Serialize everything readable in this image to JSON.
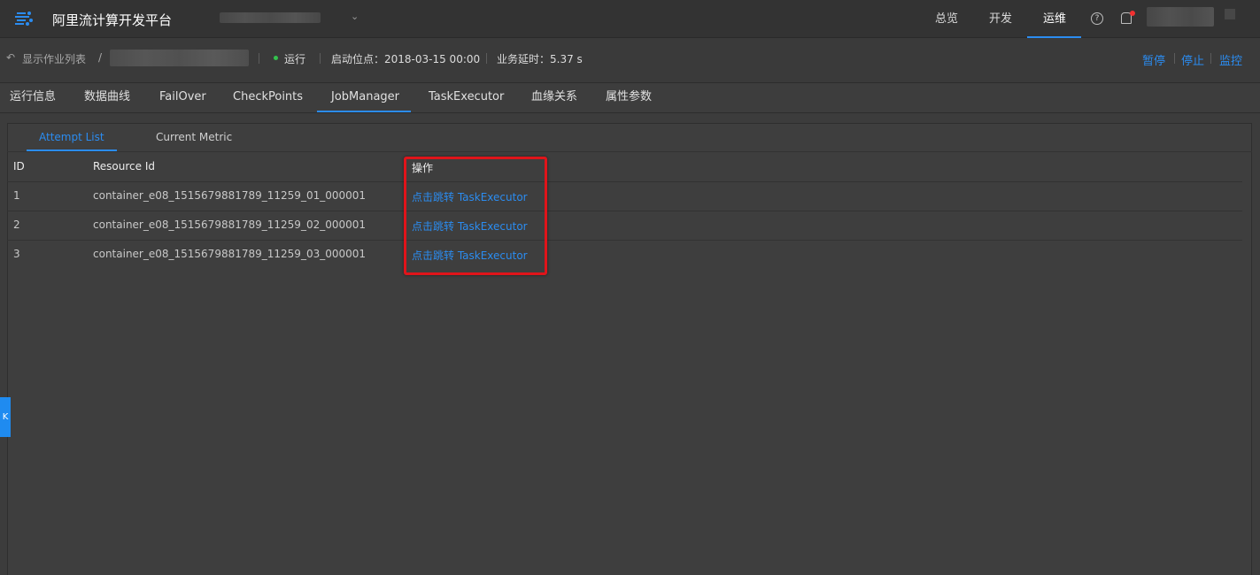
{
  "topbar": {
    "app_title": "阿里流计算开发平台",
    "nav": [
      {
        "label": "总览"
      },
      {
        "label": "开发"
      },
      {
        "label": "运维"
      }
    ],
    "help_icon": "?",
    "icons": [
      "logo-icon",
      "chevron-down-icon",
      "help-icon",
      "bell-icon"
    ]
  },
  "subheader": {
    "back_label": "显示作业列表",
    "separator": "/",
    "status": "运行",
    "start_label": "启动位点：2018-03-15 00:00",
    "delay_label": "业务延时：5.37 s",
    "actions": {
      "pause": "暂停",
      "stop": "停止",
      "monitor": "监控"
    },
    "status_color": "#33c24d"
  },
  "tabs": [
    {
      "label": "运行信息"
    },
    {
      "label": "数据曲线"
    },
    {
      "label": "FailOver"
    },
    {
      "label": "CheckPoints"
    },
    {
      "label": "JobManager"
    },
    {
      "label": "TaskExecutor"
    },
    {
      "label": "血缘关系"
    },
    {
      "label": "属性参数"
    }
  ],
  "active_tab": "JobManager",
  "subtabs": [
    {
      "label": "Attempt List"
    },
    {
      "label": "Current Metric"
    }
  ],
  "table": {
    "headers": [
      "ID",
      "Resource Id",
      "操作"
    ],
    "rows": [
      {
        "id": "1",
        "resource_id": "container_e08_1515679881789_11259_01_000001",
        "action": "点击跳转 TaskExecutor"
      },
      {
        "id": "2",
        "resource_id": "container_e08_1515679881789_11259_02_000001",
        "action": "点击跳转 TaskExecutor"
      },
      {
        "id": "3",
        "resource_id": "container_e08_1515679881789_11259_03_000001",
        "action": "点击跳转 TaskExecutor"
      }
    ]
  },
  "side_toggle": "K",
  "colors": {
    "accent": "#2b8cf0",
    "highlight": "#e0141a",
    "background": "#3c3c3c"
  }
}
